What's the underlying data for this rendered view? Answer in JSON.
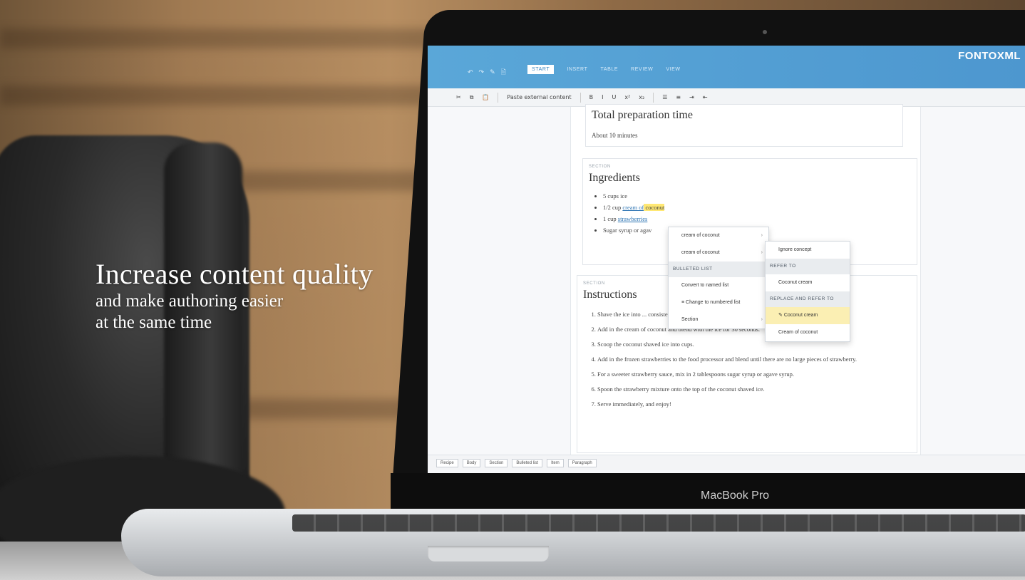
{
  "hero": {
    "title": "Increase content quality",
    "line2": "and make authoring easier",
    "line3": "at the same time"
  },
  "app": {
    "logo": "FONTOXML",
    "tabs": [
      "START",
      "INSERT",
      "TABLE",
      "REVIEW",
      "VIEW"
    ],
    "active_tab": "START",
    "toolbar": {
      "paste_external": "Paste external content",
      "format_icons": [
        "B",
        "I",
        "U",
        "x²",
        "x₂"
      ]
    }
  },
  "doc": {
    "prep": {
      "title": "Total preparation time",
      "text": "About 10 minutes"
    },
    "ingredients": {
      "label": "SECTION",
      "title": "Ingredients",
      "items": [
        {
          "pre": "5 cups ice",
          "link": "",
          "post": ""
        },
        {
          "pre": "1/2 cup ",
          "link": "cream of",
          "post": " coconut"
        },
        {
          "pre": "1 cup ",
          "link": "strawberries",
          "post": ""
        },
        {
          "pre": "Sugar syrup or agav",
          "link": "",
          "post": ""
        }
      ]
    },
    "instructions": {
      "label": "SECTION",
      "title": "Instructions",
      "steps": [
        "Shave the ice into ... consistency. There should be no large pieces.",
        "Add in the cream of coconut and blend with the ice for 30 seconds.",
        "Scoop the coconut shaved ice into cups.",
        "Add in the frozen strawberries to the food processor and blend until there are no large pieces of strawberry.",
        "For a sweeter strawberry sauce, mix in 2 tablespoons sugar syrup or agave syrup.",
        "Spoon the strawberry mixture onto the top of the coconut shaved ice.",
        "Serve immediately, and enjoy!"
      ]
    }
  },
  "context_menu": {
    "items": [
      "cream of coconut",
      "cream of coconut"
    ],
    "bulleted_header": "BULLETED LIST",
    "convert": "Convert to named list",
    "change": "Change to numbered list",
    "section": "Section"
  },
  "submenu": {
    "ignore": "Ignore concept",
    "refer_header": "REFER TO",
    "refer_item": "Coconut cream",
    "replace_header": "REPLACE AND REFER TO",
    "replace_items": [
      "Coconut cream",
      "Cream of coconut"
    ]
  },
  "breadcrumbs": [
    "Recipe",
    "Body",
    "Section",
    "Bulleted list",
    "Item",
    "Paragraph"
  ],
  "laptop_label": "MacBook Pro"
}
